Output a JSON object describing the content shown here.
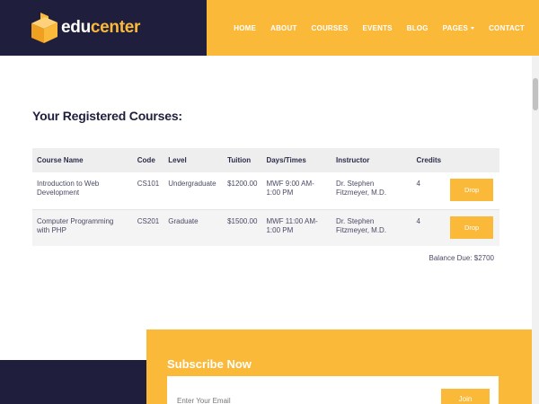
{
  "brand": {
    "edu": "edu",
    "center": "center"
  },
  "nav": [
    {
      "label": "HOME"
    },
    {
      "label": "ABOUT"
    },
    {
      "label": "COURSES"
    },
    {
      "label": "EVENTS"
    },
    {
      "label": "BLOG"
    },
    {
      "label": "PAGES"
    },
    {
      "label": "CONTACT"
    }
  ],
  "main": {
    "title": "Your Registered Courses:",
    "columns": [
      "Course Name",
      "Code",
      "Level",
      "Tuition",
      "Days/Times",
      "Instructor",
      "Credits",
      ""
    ],
    "rows": [
      {
        "name": "Introduction to Web Development",
        "code": "CS101",
        "level": "Undergraduate",
        "tuition": "$1200.00",
        "times": "MWF 9:00 AM-1:00 PM",
        "instructor": "Dr. Stephen Fitzmeyer, M.D.",
        "credits": "4",
        "action": "Drop"
      },
      {
        "name": "Computer Programming with PHP",
        "code": "CS201",
        "level": "Graduate",
        "tuition": "$1500.00",
        "times": "MWF 11:00 AM-1:00 PM",
        "instructor": "Dr. Stephen Fitzmeyer, M.D.",
        "credits": "4",
        "action": "Drop"
      }
    ],
    "balance": "Balance Due: $2700"
  },
  "subscribe": {
    "title": "Subscribe Now",
    "placeholder": "Enter Your Email",
    "button": "Join"
  },
  "colors": {
    "accent": "#fbb93a",
    "navy": "#1f1f3d"
  }
}
